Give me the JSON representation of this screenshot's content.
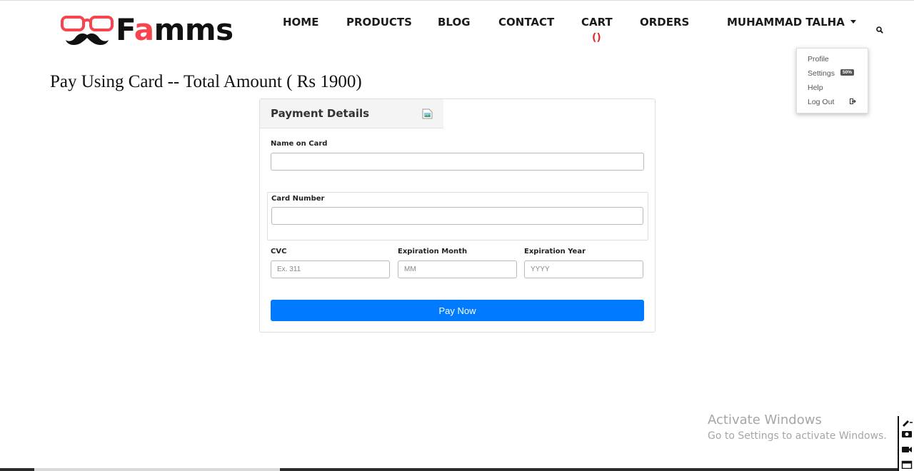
{
  "brand": {
    "logo_left": "F",
    "logo_accent": "a",
    "logo_right": "mms"
  },
  "nav": {
    "home": "HOME",
    "products": "PRODUCTS",
    "blog": "BLOG",
    "contact": "CONTACT",
    "cart": "CART",
    "cart_count": "()",
    "orders": "ORDERS",
    "user": "MUHAMMAD TALHA"
  },
  "user_menu": {
    "profile": "Profile",
    "settings": "Settings",
    "settings_badge": "50%",
    "help": "Help",
    "logout": "Log Out"
  },
  "page": {
    "title": "Pay Using Card -- Total Amount ( Rs 1900)"
  },
  "payment": {
    "header": "Payment Details",
    "name_label": "Name on Card",
    "name_value": "",
    "card_label": "Card Number",
    "card_value": "",
    "cvc_label": "CVC",
    "cvc_placeholder": "Ex. 311",
    "month_label": "Expiration Month",
    "month_placeholder": "MM",
    "year_label": "Expiration Year",
    "year_placeholder": "YYYY",
    "pay_button": "Pay Now"
  },
  "watermark": {
    "line1": "Activate Windows",
    "line2": "Go to Settings to activate Windows."
  },
  "colors": {
    "accent": "#f7444e",
    "primary_button": "#007bff",
    "cart_count": "#e02b2b"
  },
  "icons": [
    "search-icon",
    "caret-down-icon",
    "logout-icon",
    "broken-image-icon"
  ]
}
